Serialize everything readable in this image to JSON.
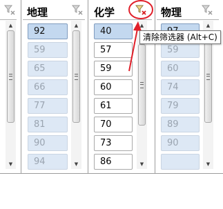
{
  "slicers": [
    {
      "title": "",
      "items": [
        "",
        "",
        "",
        "",
        "",
        "",
        "",
        ""
      ]
    },
    {
      "title": "地理",
      "items": [
        "92",
        "59",
        "65",
        "66",
        "77",
        "81",
        "90",
        "94"
      ]
    },
    {
      "title": "化学",
      "items": [
        "40",
        "57",
        "59",
        "60",
        "61",
        "70",
        "73",
        "86"
      ]
    },
    {
      "title": "物理",
      "items": [
        "97",
        "59",
        "60",
        "74",
        "79",
        "89",
        "90",
        ""
      ]
    }
  ],
  "tooltip": "清除筛选器 (Alt+C)",
  "icons": {
    "clear_filter": "clear-filter-icon",
    "annotation_circle": "red-circle",
    "annotation_arrow": "red-arrow"
  },
  "colors": {
    "selected_item": "#c3d8ef",
    "unavailable_item": "#dde8f5",
    "annotation": "#e0202a"
  }
}
